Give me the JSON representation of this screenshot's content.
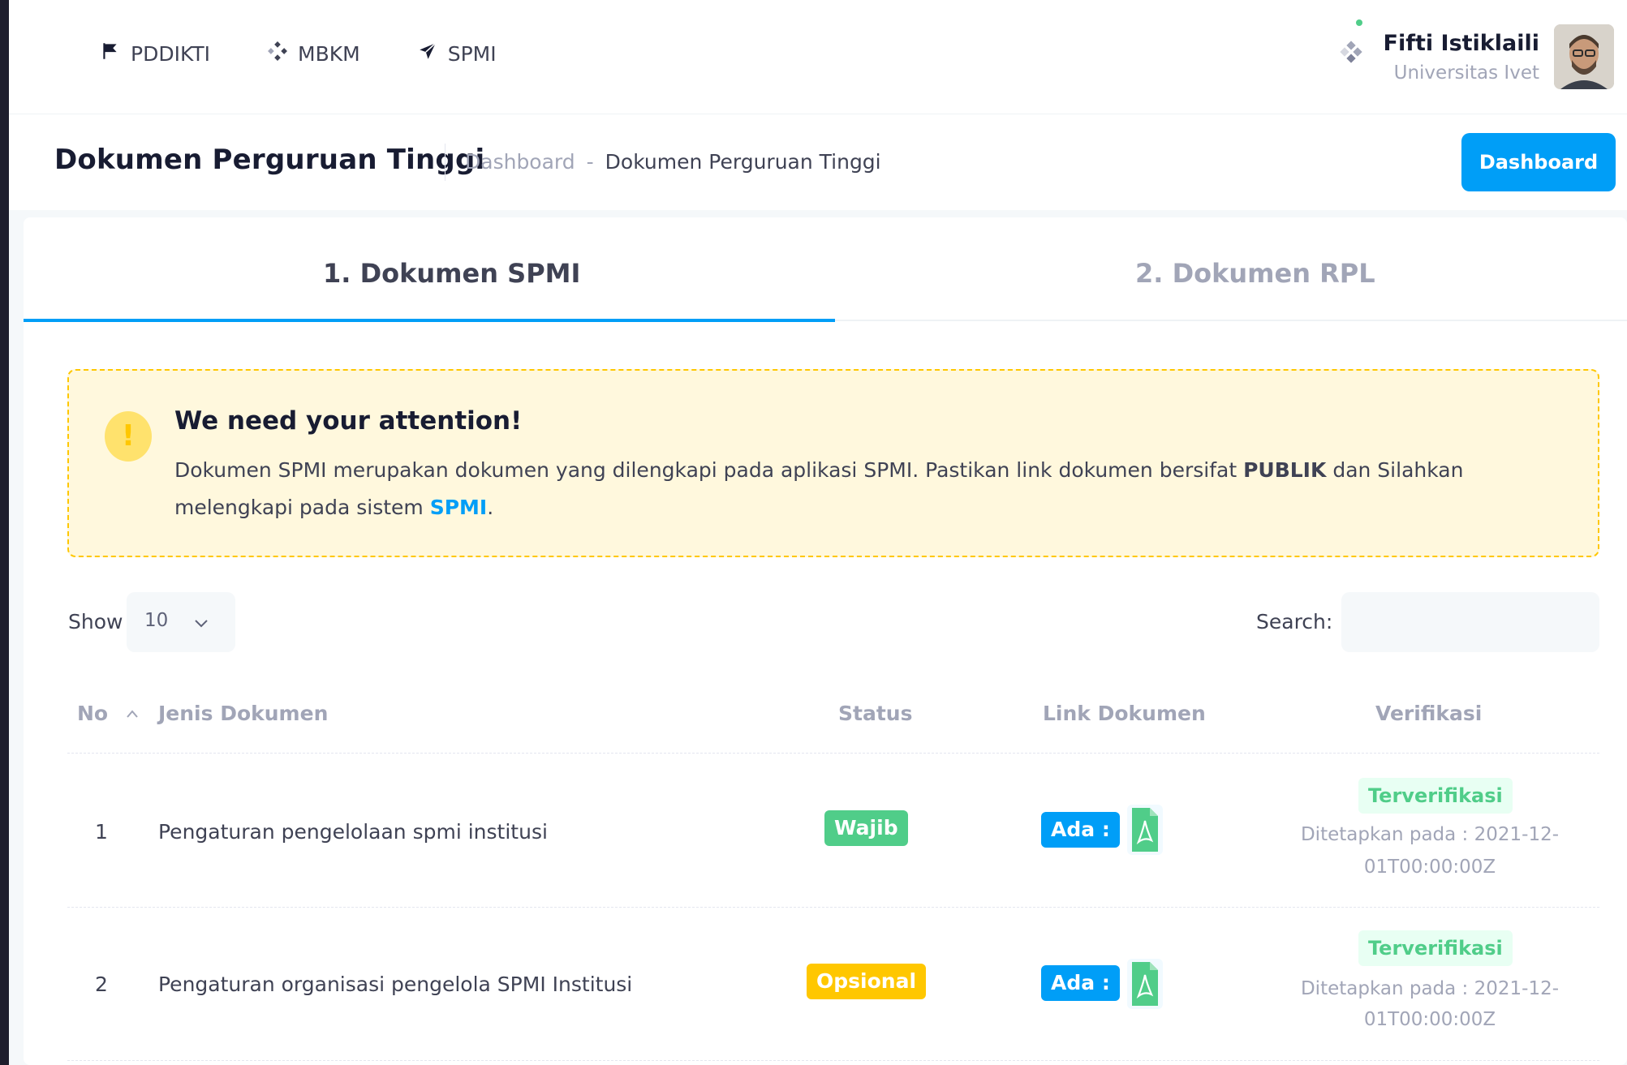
{
  "header": {
    "nav": [
      {
        "label": "PDDIKTI",
        "icon": "flag-icon"
      },
      {
        "label": "MBKM",
        "icon": "dots-diamond-icon"
      },
      {
        "label": "SPMI",
        "icon": "paper-plane-icon"
      }
    ],
    "user": {
      "name": "Fifti Istiklaili",
      "org": "Universitas Ivet"
    }
  },
  "toolbar": {
    "title": "Dokumen Perguruan Tinggi",
    "breadcrumb": {
      "home": "Dashboard",
      "sep": "-",
      "current": "Dokumen Perguruan Tinggi"
    },
    "button": "Dashboard"
  },
  "tabs": [
    {
      "label": "1. Dokumen SPMI",
      "active": true
    },
    {
      "label": "2. Dokumen RPL",
      "active": false
    }
  ],
  "alert": {
    "title": "We need your attention!",
    "text_1": "Dokumen SPMI merupakan dokumen yang dilengkapi pada aplikasi SPMI. Pastikan link dokumen bersifat ",
    "bold": "PUBLIK",
    "text_2": " dan Silahkan melengkapi pada sistem ",
    "link": "SPMI",
    "text_3": "."
  },
  "controls": {
    "show_label": "Show",
    "page_length": "10",
    "search_label": "Search:",
    "search_value": ""
  },
  "table": {
    "headers": {
      "no": "No",
      "jenis": "Jenis Dokumen",
      "status": "Status",
      "link": "Link Dokumen",
      "verifikasi": "Verifikasi"
    },
    "rows": [
      {
        "no": "1",
        "jenis": "Pengaturan pengelolaan spmi institusi",
        "status": "Wajib",
        "link": "Ada :",
        "verif": "Terverifikasi",
        "date_1": "Ditetapkan pada : 2021-12-",
        "date_2": "01T00:00:00Z"
      },
      {
        "no": "2",
        "jenis": "Pengaturan organisasi pengelola SPMI Institusi",
        "status": "Opsional",
        "link": "Ada :",
        "verif": "Terverifikasi",
        "date_1": "Ditetapkan pada : 2021-12-",
        "date_2": "01T00:00:00Z"
      }
    ]
  },
  "colors": {
    "primary": "#009ef7",
    "success": "#50cd89",
    "warning": "#ffc700",
    "warning_light": "#fff8dd"
  }
}
